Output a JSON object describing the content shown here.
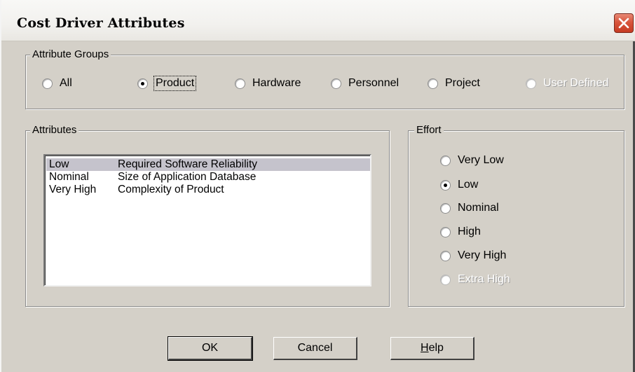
{
  "window": {
    "title": "Cost Driver Attributes"
  },
  "attribute_groups": {
    "legend": "Attribute Groups",
    "options": [
      {
        "label": "All",
        "checked": false,
        "disabled": false
      },
      {
        "label": "Product",
        "checked": true,
        "disabled": false
      },
      {
        "label": "Hardware",
        "checked": false,
        "disabled": false
      },
      {
        "label": "Personnel",
        "checked": false,
        "disabled": false
      },
      {
        "label": "Project",
        "checked": false,
        "disabled": false
      },
      {
        "label": "User Defined",
        "checked": false,
        "disabled": true
      }
    ]
  },
  "attributes": {
    "legend": "Attributes",
    "rows": [
      {
        "rating": "Low",
        "name": "Required Software Reliability",
        "selected": true
      },
      {
        "rating": "Nominal",
        "name": "Size of Application Database",
        "selected": false
      },
      {
        "rating": "Very High",
        "name": "Complexity of Product",
        "selected": false
      }
    ]
  },
  "effort": {
    "legend": "Effort",
    "options": [
      {
        "label": "Very Low",
        "checked": false,
        "disabled": false
      },
      {
        "label": "Low",
        "checked": true,
        "disabled": false
      },
      {
        "label": "Nominal",
        "checked": false,
        "disabled": false
      },
      {
        "label": "High",
        "checked": false,
        "disabled": false
      },
      {
        "label": "Very High",
        "checked": false,
        "disabled": false
      },
      {
        "label": "Extra High",
        "checked": false,
        "disabled": true
      }
    ]
  },
  "buttons": {
    "ok": "OK",
    "cancel": "Cancel",
    "help": "Help"
  },
  "colors": {
    "dialog_bg": "#d4d0c8",
    "selection": "#c5c3cc",
    "close_button": "#d8553c"
  }
}
